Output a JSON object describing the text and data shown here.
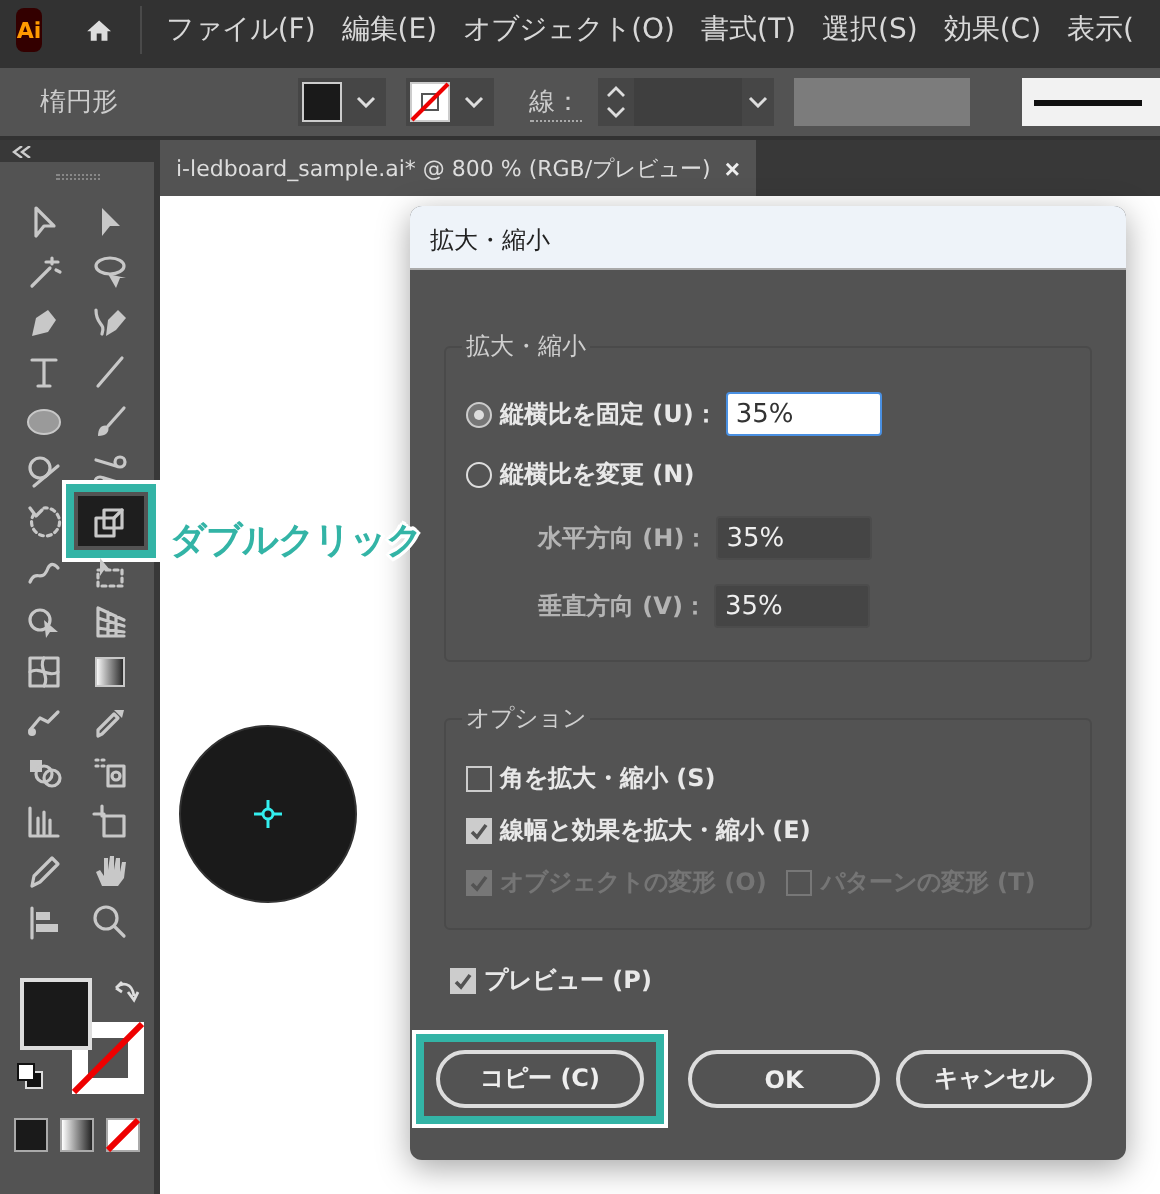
{
  "app_logo": "Ai",
  "menu_bar": {
    "items": [
      {
        "label": "ファイル(F)"
      },
      {
        "label": "編集(E)"
      },
      {
        "label": "オブジェクト(O)"
      },
      {
        "label": "書式(T)"
      },
      {
        "label": "選択(S)"
      },
      {
        "label": "効果(C)"
      },
      {
        "label": "表示("
      }
    ]
  },
  "control_bar": {
    "object_type": "楕円形",
    "stroke_label": "線："
  },
  "document_tab": {
    "title": "i-ledboard_sample.ai* @ 800 % (RGB/プレビュー)",
    "close": "×"
  },
  "tools": [
    {
      "kind": "select",
      "selected": false,
      "highlighted": false
    },
    {
      "kind": "direct-select",
      "selected": false,
      "highlighted": false
    },
    {
      "kind": "wand",
      "selected": false,
      "highlighted": false
    },
    {
      "kind": "lasso",
      "selected": false,
      "highlighted": false
    },
    {
      "kind": "pen",
      "selected": false,
      "highlighted": false
    },
    {
      "kind": "curvature",
      "selected": false,
      "highlighted": false
    },
    {
      "kind": "type",
      "selected": false,
      "highlighted": false
    },
    {
      "kind": "line",
      "selected": false,
      "highlighted": false
    },
    {
      "kind": "ellipse",
      "selected": false,
      "highlighted": false
    },
    {
      "kind": "brush",
      "selected": false,
      "highlighted": false
    },
    {
      "kind": "shaper",
      "selected": false,
      "highlighted": false
    },
    {
      "kind": "scissors",
      "selected": false,
      "highlighted": false
    },
    {
      "kind": "rotate",
      "selected": false,
      "highlighted": false
    },
    {
      "kind": "scale",
      "selected": true,
      "highlighted": true
    },
    {
      "kind": "warp",
      "selected": false,
      "highlighted": false
    },
    {
      "kind": "transform",
      "selected": false,
      "highlighted": false
    },
    {
      "kind": "builder",
      "selected": false,
      "highlighted": false
    },
    {
      "kind": "perspective",
      "selected": false,
      "highlighted": false
    },
    {
      "kind": "mesh",
      "selected": false,
      "highlighted": false
    },
    {
      "kind": "gradient",
      "selected": false,
      "highlighted": false
    },
    {
      "kind": "blend",
      "selected": false,
      "highlighted": false
    },
    {
      "kind": "eyedropper",
      "selected": false,
      "highlighted": false
    },
    {
      "kind": "sprayer",
      "selected": false,
      "highlighted": false
    },
    {
      "kind": "paint",
      "selected": false,
      "highlighted": false
    },
    {
      "kind": "graph",
      "selected": false,
      "highlighted": false
    },
    {
      "kind": "artboard",
      "selected": false,
      "highlighted": false
    },
    {
      "kind": "pencil",
      "selected": false,
      "highlighted": false
    },
    {
      "kind": "hand",
      "selected": false,
      "highlighted": false
    },
    {
      "kind": "align",
      "selected": false,
      "highlighted": false
    },
    {
      "kind": "zoom",
      "selected": false,
      "highlighted": false
    }
  ],
  "annotation": {
    "text": "ダブルクリック"
  },
  "dialog": {
    "title": "拡大・縮小",
    "scale_group": {
      "legend": "拡大・縮小",
      "radios": [
        {
          "label": "縦横比を固定 (U)：",
          "selected": true,
          "value": "35%",
          "focused": true
        },
        {
          "label": "縦横比を変更 (N)",
          "selected": false
        }
      ],
      "fields": [
        {
          "label": "水平方向 (H)：",
          "value": "35%"
        },
        {
          "label": "垂直方向 (V)：",
          "value": "35%"
        }
      ]
    },
    "options_group": {
      "legend": "オプション",
      "rows": [
        {
          "checkboxes": [
            {
              "label": "角を拡大・縮小 (S)",
              "checked": false,
              "disabled": false
            }
          ]
        },
        {
          "checkboxes": [
            {
              "label": "線幅と効果を拡大・縮小 (E)",
              "checked": true,
              "disabled": false
            }
          ]
        },
        {
          "checkboxes": [
            {
              "label": "オブジェクトの変形 (O)",
              "checked": true,
              "disabled": true
            },
            {
              "label": "パターンの変形 (T)",
              "checked": false,
              "disabled": true
            }
          ]
        }
      ]
    },
    "preview": {
      "label": "プレビュー (P)",
      "checked": true
    },
    "buttons": [
      {
        "label": "コピー (C)",
        "highlighted": true
      },
      {
        "label": "OK",
        "highlighted": false
      },
      {
        "label": "キャンセル",
        "highlighted": false
      }
    ]
  }
}
